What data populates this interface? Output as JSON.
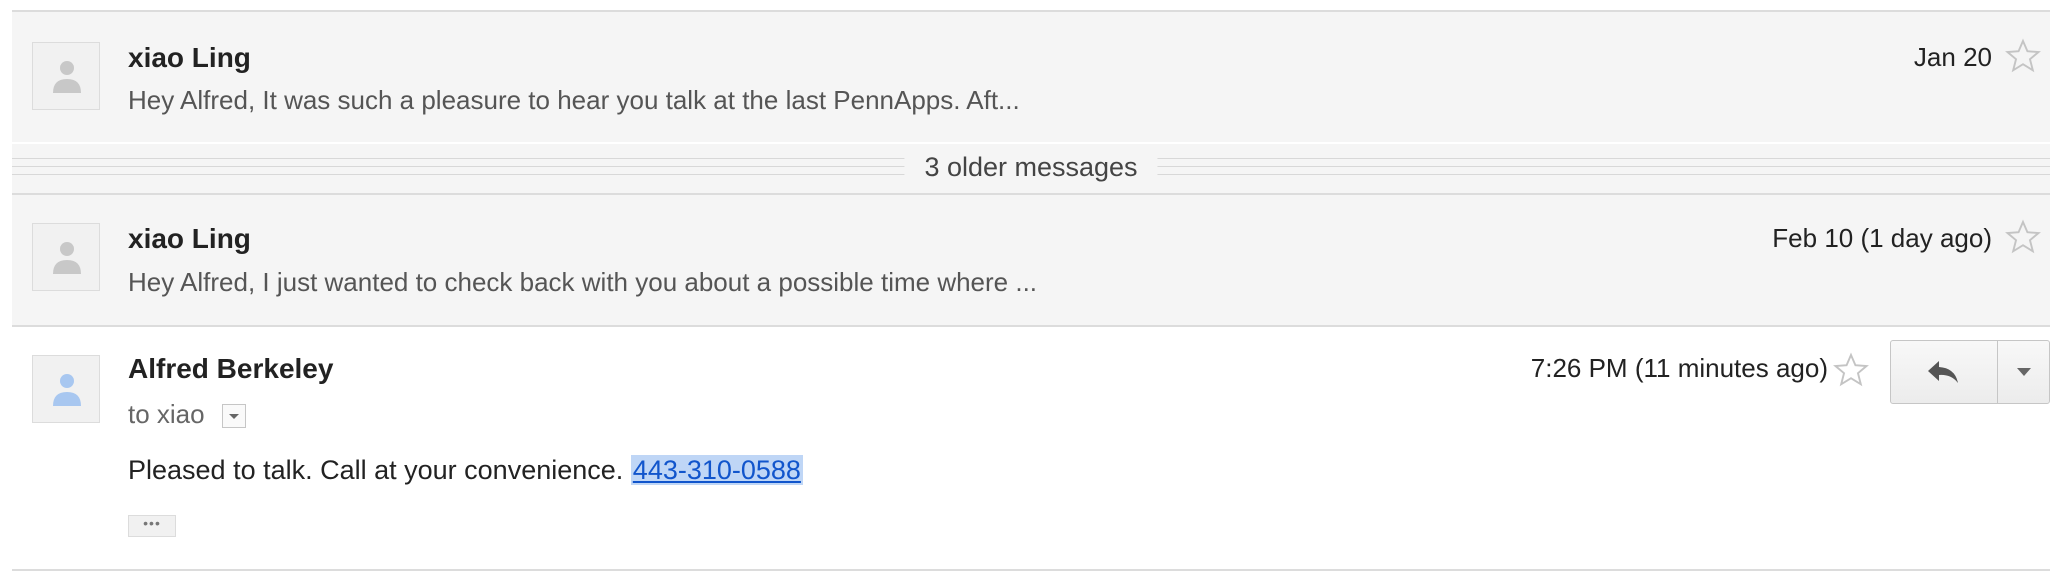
{
  "messages": [
    {
      "sender": "xiao Ling",
      "snippet": "Hey Alfred, It was such a pleasure to hear you talk at the last PennApps. Aft...",
      "date": "Jan 20",
      "starred": false
    },
    {
      "sender": "xiao Ling",
      "snippet": "Hey Alfred, I just wanted to check back with you about a possible time where ...",
      "date": "Feb 10 (1 day ago)",
      "starred": false
    }
  ],
  "older_messages_label": "3 older messages",
  "expanded_message": {
    "sender": "Alfred Berkeley",
    "to_line": "to xiao",
    "date": "7:26 PM (11 minutes ago)",
    "starred": false,
    "body_text": "Pleased to talk. Call at your convenience. ",
    "phone_link": "443-310-0588",
    "trimmed_content_label": "•••"
  },
  "colors": {
    "collapsed_bg": "#f5f5f5",
    "link": "#1155cc",
    "selection": "#bfd6f6",
    "avatar_gray": "#c8c8c8",
    "avatar_blue": "#a8c7f0"
  },
  "icons": {
    "avatar": "person-silhouette-icon",
    "star": "star-outline-icon",
    "reply": "reply-arrow-icon",
    "menu": "dropdown-triangle-icon"
  }
}
